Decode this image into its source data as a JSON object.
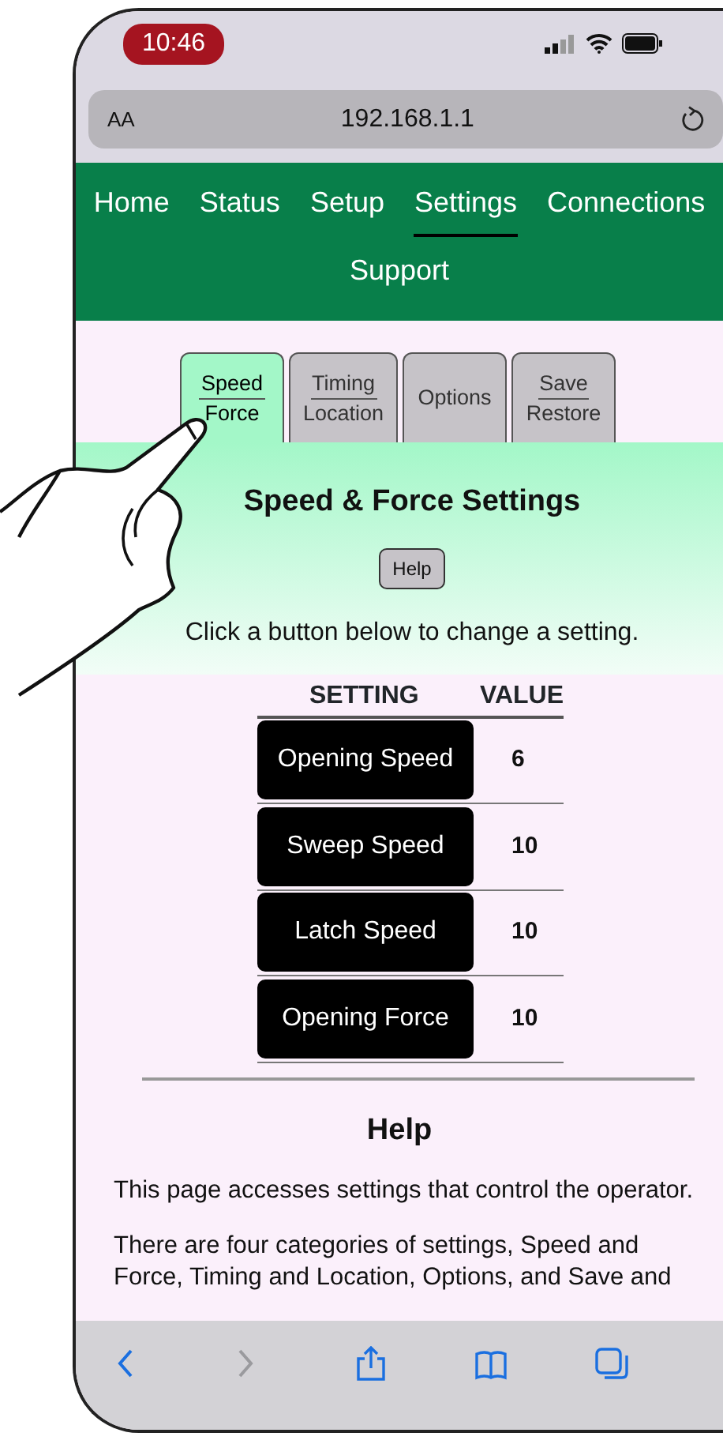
{
  "status_bar": {
    "time": "10:46"
  },
  "url_bar": {
    "text_size": "AA",
    "address": "192.168.1.1"
  },
  "nav": [
    {
      "label": "Home",
      "selected": false
    },
    {
      "label": "Status",
      "selected": false
    },
    {
      "label": "Setup",
      "selected": false
    },
    {
      "label": "Settings",
      "selected": true
    },
    {
      "label": "Connections",
      "selected": false
    },
    {
      "label": "Support",
      "selected": false
    }
  ],
  "tabs": [
    {
      "lines": [
        "Speed",
        "Force"
      ],
      "selected": true
    },
    {
      "lines": [
        "Timing",
        "Location"
      ],
      "selected": false
    },
    {
      "lines": [
        "Options"
      ],
      "selected": false
    },
    {
      "lines": [
        "Save",
        "Restore"
      ],
      "selected": false
    }
  ],
  "panel": {
    "title": "Speed & Force Settings",
    "help_button": "Help",
    "instruction": "Click a button below to change a setting."
  },
  "table": {
    "columns": [
      "SETTING",
      "VALUE"
    ],
    "rows": [
      {
        "setting": "Opening Speed",
        "value": "6"
      },
      {
        "setting": "Sweep Speed",
        "value": "10"
      },
      {
        "setting": "Latch Speed",
        "value": "10"
      },
      {
        "setting": "Opening Force",
        "value": "10"
      }
    ]
  },
  "help": {
    "title": "Help",
    "paragraphs": [
      "This page accesses settings that control the operator.",
      "There are four categories of settings, Speed and Force, Timing and Location, Options, and Save and"
    ]
  },
  "toolbar": [
    {
      "kind": "back",
      "disabled": false
    },
    {
      "kind": "forward",
      "disabled": true
    },
    {
      "kind": "share",
      "disabled": false
    },
    {
      "kind": "bookmarks",
      "disabled": false
    },
    {
      "kind": "tabs",
      "disabled": false
    }
  ]
}
